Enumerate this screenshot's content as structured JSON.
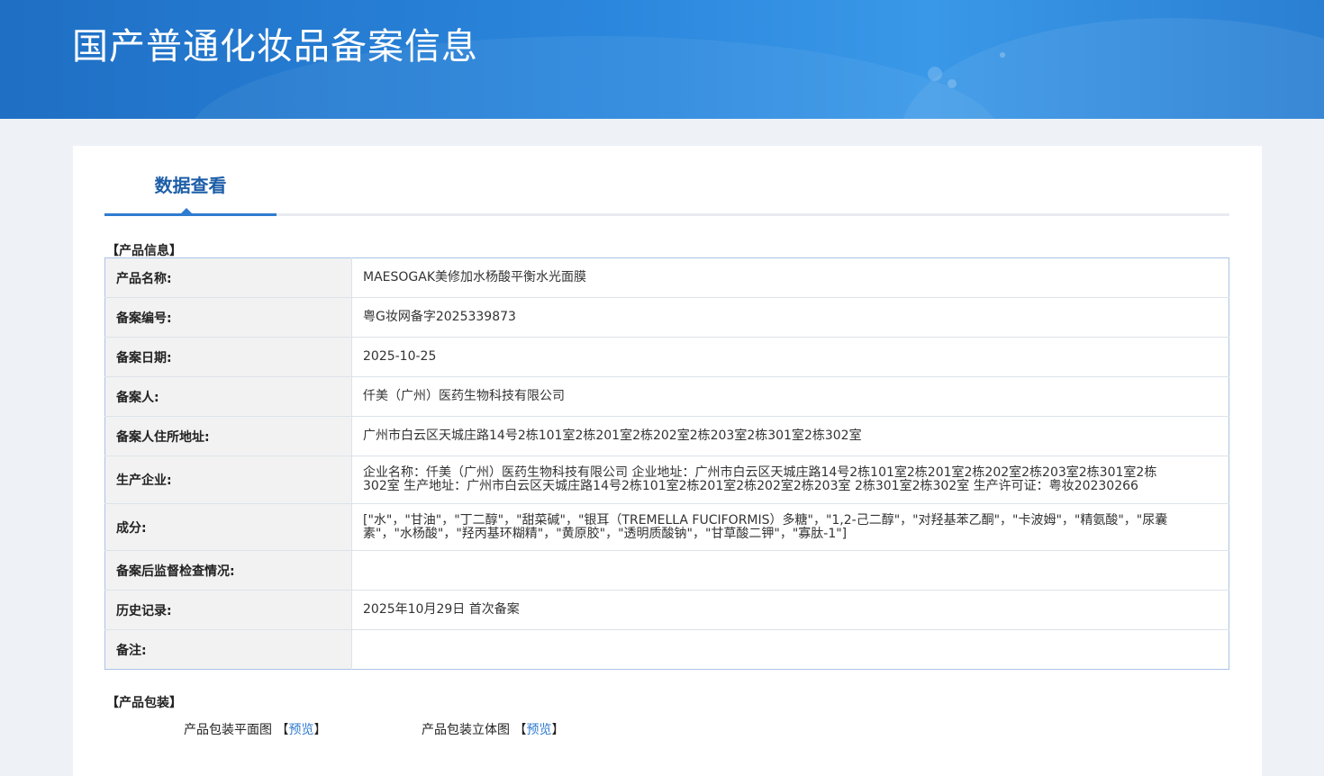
{
  "header": {
    "title": "国产普通化妆品备案信息"
  },
  "tabs": [
    {
      "label": "数据查看"
    }
  ],
  "product_info": {
    "section_title": "【产品信息】",
    "rows": [
      {
        "label": "产品名称:",
        "value": "MAESOGAK美修加水杨酸平衡水光面膜"
      },
      {
        "label": "备案编号:",
        "value": "粤G妆网备字2025339873"
      },
      {
        "label": "备案日期:",
        "value": "2025-10-25"
      },
      {
        "label": "备案人:",
        "value": "仟美（广州）医药生物科技有限公司"
      },
      {
        "label": "备案人住所地址:",
        "value": "广州市白云区天城庄路14号2栋101室2栋201室2栋202室2栋203室2栋301室2栋302室"
      },
      {
        "label": "生产企业:",
        "value": "企业名称：仟美（广州）医药生物科技有限公司 企业地址：广州市白云区天城庄路14号2栋101室2栋201室2栋202室2栋203室2栋301室2栋302室 生产地址：广州市白云区天城庄路14号2栋101室2栋201室2栋202室2栋203室 2栋301室2栋302室 生产许可证：粤妆20230266"
      },
      {
        "label": "成分:",
        "value": "[\"水\"，\"甘油\"，\"丁二醇\"，\"甜菜碱\"，\"银耳（TREMELLA FUCIFORMIS）多糖\"，\"1,2-己二醇\"，\"对羟基苯乙酮\"，\"卡波姆\"，\"精氨酸\"，\"尿囊素\"，\"水杨酸\"，\"羟丙基环糊精\"，\"黄原胶\"，\"透明质酸钠\"，\"甘草酸二钾\"，\"寡肽-1\"]"
      },
      {
        "label": "备案后监督检查情况:",
        "value": ""
      },
      {
        "label": "历史记录:",
        "value": "2025年10月29日 首次备案"
      },
      {
        "label": "备注:",
        "value": ""
      }
    ]
  },
  "packaging": {
    "section_title": "【产品包装】",
    "flat_label": "产品包装平面图",
    "stereo_label": "产品包装立体图",
    "bracket_open": "【",
    "bracket_close": "】",
    "preview_label": "预览"
  }
}
